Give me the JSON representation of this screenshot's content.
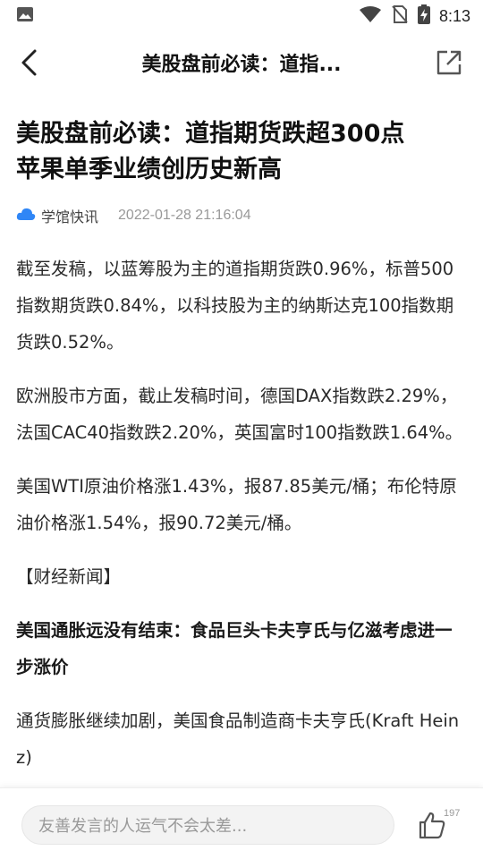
{
  "status_bar": {
    "time": "8:13",
    "icons": [
      "image-icon",
      "wifi-icon",
      "no-sim-icon",
      "battery-charging-icon"
    ]
  },
  "nav": {
    "title": "美股盘前必读：道指...",
    "back_icon": "chevron-left-icon",
    "share_icon": "share-external-icon"
  },
  "article": {
    "headline_line1": "美股盘前必读：道指期货跌超300点",
    "headline_line2": "苹果单季业绩创历史新高",
    "source": "学馆快讯",
    "source_icon": "cloud-icon",
    "timestamp": "2022-01-28 21:16:04",
    "paragraphs": [
      {
        "text": "截至发稿，以蓝筹股为主的道指期货跌0.96%，标普500指数期货跌0.84%，以科技股为主的纳斯达克100指数期货跌0.52%。",
        "style": "normal"
      },
      {
        "text": "欧洲股市方面，截止发稿时间，德国DAX指数跌2.29%，法国CAC40指数跌2.20%，英国富时100指数跌1.64%。",
        "style": "normal"
      },
      {
        "text": "美国WTI原油价格涨1.43%，报87.85美元/桶；布伦特原油价格涨1.54%，报90.72美元/桶。",
        "style": "normal"
      },
      {
        "text": "【财经新闻】",
        "style": "section"
      },
      {
        "text": "美国通胀远没有结束：食品巨头卡夫亨氏与亿滋考虑进一步涨价",
        "style": "bold"
      },
      {
        "text": "通货膨胀继续加剧，美国食品制造商卡夫亨氏(Kraft Heinz)",
        "style": "normal"
      }
    ]
  },
  "bottom_bar": {
    "comment_placeholder": "友善发言的人运气不会太差...",
    "like_count": "197",
    "like_icon": "thumbs-up-icon"
  },
  "colors": {
    "accent_blue": "#2f86f6",
    "text_primary": "#222222",
    "text_muted": "#999999"
  }
}
